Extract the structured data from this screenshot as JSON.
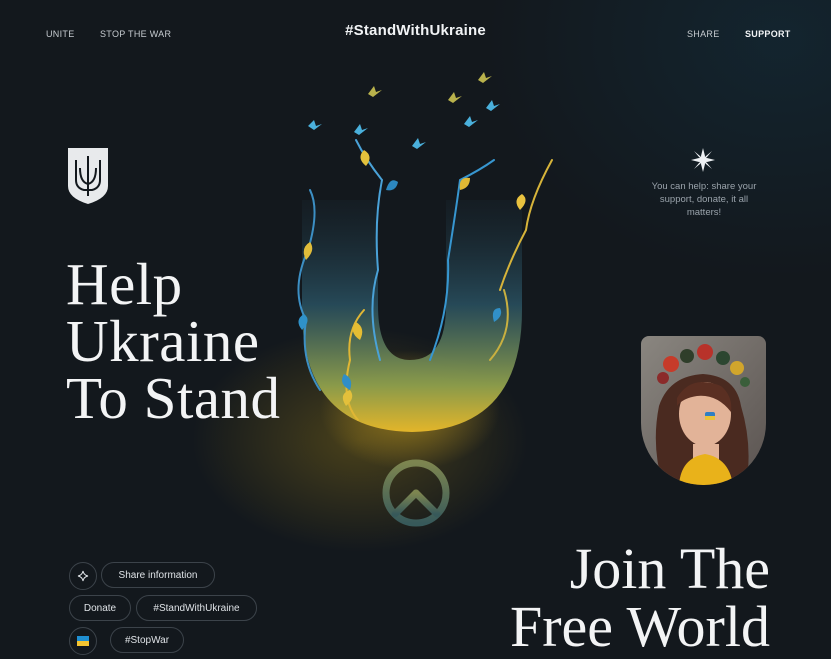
{
  "nav": {
    "left_links": [
      "UNITE",
      "STOP THE WAR"
    ],
    "brand": "#StandWithUkraine",
    "right_links": [
      "SHARE",
      "SUPPORT"
    ]
  },
  "hero": {
    "title_lines": [
      "Help",
      "Ukraine",
      "To Stand"
    ]
  },
  "side": {
    "text": "You can help: share your support, donate, it all matters!"
  },
  "pills": {
    "share": "Share information",
    "donate": "Donate",
    "hashtag1": "#StandWithUkraine",
    "hashtag2": "#StopWar"
  },
  "join": {
    "title_lines": [
      "Join The",
      "Free World"
    ]
  },
  "colors": {
    "background": "#13181d",
    "ukraine_blue": "#1f8fd1",
    "ukraine_yellow": "#f4c430"
  },
  "icons": [
    "trident-icon",
    "sparkle-icon",
    "sun-icon",
    "peace-icon",
    "ukraine-flag-icon"
  ]
}
